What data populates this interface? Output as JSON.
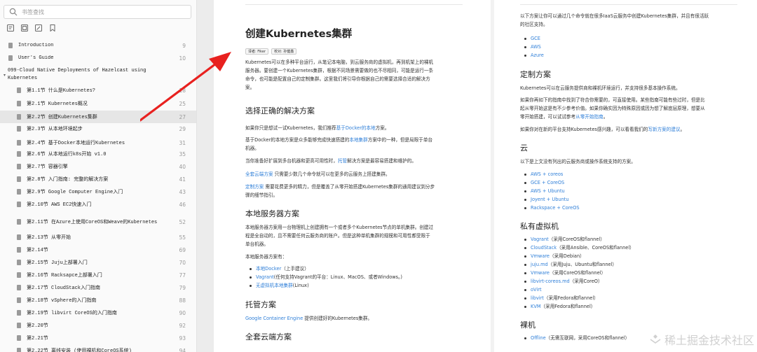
{
  "sidebar": {
    "search_placeholder": "书签查找",
    "toolbar_icons": [
      "outline-icon",
      "thumbnail-icon",
      "annotation-icon",
      "bookmark-icon"
    ],
    "items": [
      {
        "label": "Introduction",
        "page": "9",
        "level": 0
      },
      {
        "label": "User's Guide",
        "page": "10",
        "level": 0
      },
      {
        "label": "099-Cloud Native Deployments of Hazelcast using Kubernetes",
        "page": "",
        "level": 0,
        "parent": true
      },
      {
        "label": "第1.1节 什么是Kubernetes?",
        "page": "18",
        "level": 1
      },
      {
        "label": "第2.1节 Kubernetes概况",
        "page": "25",
        "level": 1
      },
      {
        "label": "第2.2节 创建Kubernetes集群",
        "page": "27",
        "level": 1,
        "active": true
      },
      {
        "label": "第2.3节 从本地环境起步",
        "page": "29",
        "level": 1
      },
      {
        "label": "第2.4节 基于Docker本地运行Kubernetes",
        "page": "31",
        "level": 1
      },
      {
        "label": "第2.6节 从本地运行k8s开始 v1.0",
        "page": "35",
        "level": 1
      },
      {
        "label": "第2.7节 容器引擎",
        "page": "40",
        "level": 1
      },
      {
        "label": "第2.8节 入门指南: 完整的解决方案",
        "page": "41",
        "level": 1
      },
      {
        "label": "第2.9节 Google Computer Engine入门",
        "page": "43",
        "level": 1
      },
      {
        "label": "第2.10节 AWS EC2快速入门",
        "page": "46",
        "level": 1
      },
      {
        "label": "第2.11节 在Azure上使用CoreOS和Weave的Kubernetes",
        "page": "52",
        "level": 1
      },
      {
        "label": "第2.13节 从零开始",
        "page": "55",
        "level": 1
      },
      {
        "label": "第2.14节",
        "page": "69",
        "level": 1
      },
      {
        "label": "第2.15节 Juju上部署入门",
        "page": "70",
        "level": 1
      },
      {
        "label": "第2.16节 Racksapce上部署入门",
        "page": "77",
        "level": 1
      },
      {
        "label": "第2.17节 CloudStack入门指南",
        "page": "79",
        "level": 1
      },
      {
        "label": "第2.18节 vSphere的入门指南",
        "page": "88",
        "level": 1
      },
      {
        "label": "第2.19节 libvirt CoreOS的入门指南",
        "page": "90",
        "level": 1
      },
      {
        "label": "第2.20节",
        "page": "92",
        "level": 1
      },
      {
        "label": "第2.21节",
        "page": "93",
        "level": 1
      },
      {
        "label": "第2.22节 离线安装 (使用裸机和CoreOS系统)",
        "page": "94",
        "level": 1
      }
    ]
  },
  "page1": {
    "title": "创建Kubernetes集群",
    "meta": [
      "译者: Fiker",
      "校对: 孙健鑫"
    ],
    "intro": [
      "Kubernetes可以在多种平台运行，从笔记本电脑，到云服务商的虚拟机，再到机架上的裸机",
      "服务器。要创建一个Kubernetes集群，根据不同场景需要做的也不尽相同，可能是运行一条",
      "命令，也可能是配置自己的定制集群。这里我们将引导你根据自己的需要选择合适的解决方",
      "案。"
    ],
    "h2_select": "选择正确的解决方案",
    "p_local_pre": "如果你只是想试一试Kubernetes，我们推荐",
    "p_local_link": "基于Docker的本地",
    "p_local_post": "方案。",
    "p_docker_1_pre": "基于Docker的本地方案是众多能够完成快速搭建的",
    "p_docker_1_link": "本地集群",
    "p_docker_1_post": "方案中的一种，但是局限于单台",
    "p_docker_2": "机器。",
    "p_hosted_pre": "当你准备好扩展到多台机器和更高可用性时，",
    "p_hosted_link": "托管",
    "p_hosted_post": "解决方案是最容易搭建和维护的。",
    "p_turnkey_link": "全套云端方案",
    "p_turnkey_post": " 只需要少数几个命令就可以在更多的云服务上搭建集群。",
    "p_custom_link": "定制方案",
    "p_custom_1": " 需要花费更多的精力，但是覆盖了从零开始搭建Kubernetes集群的通用建议到分步",
    "p_custom_2": "骤的细节指引。",
    "h2_local": "本地服务器方案",
    "p_localsrv": [
      "本地服务器方案用一台物理机上创建拥有一个或者多个Kubernetes节点的单机集群。创建过",
      "程是全自动的，且不需要任何云服务商的账户。但是这种单机集群的规模和可用性都受限于",
      "单台机器。"
    ],
    "p_localsrv_has": "本地服务器方案有：",
    "local_list": [
      {
        "link": "本地Docker",
        "text": "（上手建议）"
      },
      {
        "link": "Vagrant",
        "text": " (任何支持Vagrant的平台：Linux、MacOS、或者Windows。)"
      },
      {
        "link": "无虚拟机本地集群",
        "text": " (Linux)"
      }
    ],
    "h2_hosted": "托管方案",
    "p_gce_link": "Google Container Engine",
    "p_gce_post": " 提供创建好的Kubernetes集群。",
    "h2_turnkey": "全套云端方案"
  },
  "page2": {
    "intro": [
      "以下方案让你可以通过几个命令就在很多IaaS云服务中创建Kubernetes集群，并且有很活跃",
      "的社区支持。"
    ],
    "iaas": [
      "GCE",
      "AWS",
      "Azure"
    ],
    "h2_custom": "定制方案",
    "p_custom1": "Kubernetes可以在云服务提供商和裸机环境运行，并支持很多基本操作系统。",
    "p_custom2": [
      "如果你再如下的指南中找到了符合你需要的，可直接使用。某些指南可能有些过时，但是比",
      "起从零开始这是有不少参考价值。如果你确实因为特殊原因或因为想了解底层原理，想要从"
    ],
    "p_custom2_last_pre": "零开始搭建，可以试试参考",
    "p_custom2_last_link": "从零开始指南",
    "p_custom2_last_post": "。",
    "p_custom3_pre": "如果你对在新的平台支持Kubernetes感兴趣，可以看看我们的",
    "p_custom3_link": "写新方案的建议",
    "p_custom3_post": "。",
    "h2_cloud": "云",
    "p_cloud": "以下是上文没有列出的云服务商或操作系统支持的方案。",
    "cloud_list": [
      "AWS + coreos",
      "GCE + CoreOS",
      "AWS + Ubuntu",
      "Joyent + Ubuntu",
      "Rackspace + CoreOS"
    ],
    "h2_private": "私有虚拟机",
    "private_list": [
      {
        "link": "Vagrant",
        "text": "（采用CoreOS和flannel）"
      },
      {
        "link": "CloudStack",
        "text": "（采用Ansible、CoreOS和flannel）"
      },
      {
        "link": "Vmware",
        "text": "（采用Debian）"
      },
      {
        "link": "juju.md",
        "text": "（采用Juju、Ubuntu和flannel）"
      },
      {
        "link": "Vmware",
        "text": "（采用CoreOS和flannel）"
      },
      {
        "link": "libvirt-coreos.md",
        "text": "（采用CoreO）"
      },
      {
        "link": "oVirt",
        "text": ""
      },
      {
        "link": "libvirt",
        "text": "（采用Fedora和flannel）"
      },
      {
        "link": "KVM",
        "text": "（采用Fedora和flannel）"
      }
    ],
    "h2_bare": "裸机",
    "bare_list": [
      {
        "link": "Offline",
        "text": "（无需互联网，采用CoreOS和flannel）"
      }
    ]
  },
  "watermark": "稀土掘金技术社区",
  "colors": {
    "link": "#2f7fd8",
    "arrow": "#e8211f",
    "active_row": "#e6e6e6"
  }
}
